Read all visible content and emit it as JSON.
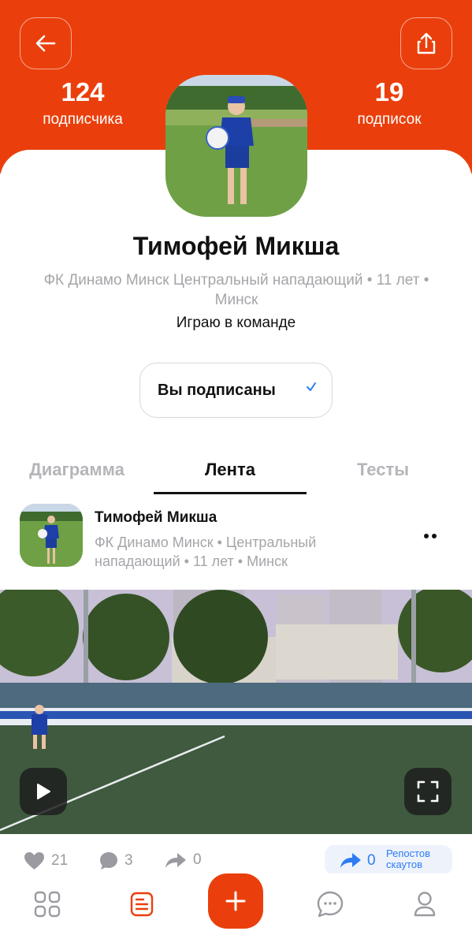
{
  "colors": {
    "accent": "#ea3f0c",
    "muted_text": "#a5a5aa",
    "link_blue": "#2d7cf6",
    "checkmark": "#2d7cf6"
  },
  "header": {
    "back_icon": "arrow-left-icon",
    "share_icon": "share-icon",
    "followers": {
      "count": "124",
      "label": "подписчика"
    },
    "following": {
      "count": "19",
      "label": "подписок"
    }
  },
  "profile": {
    "name": "Тимофей Микша",
    "meta": "ФК Динамо Минск Центральный нападающий •  11 лет • Минск",
    "status": "Играю в команде",
    "subscribe_button": "Вы подписаны",
    "subscribe_icon": "checkmark-icon"
  },
  "tabs": [
    {
      "label": "Диаграмма",
      "active": false
    },
    {
      "label": "Лента",
      "active": true
    },
    {
      "label": "Тесты",
      "active": false
    }
  ],
  "post": {
    "author": "Тимофей Микша",
    "meta": "ФК Динамо Минск •  Центральный нападающий • 11 лет • Минск",
    "more_icon": "more-dots-icon",
    "video": {
      "play_icon": "play-icon",
      "fullscreen_icon": "fullscreen-icon"
    },
    "actions": {
      "likes": "21",
      "comments": "3",
      "reposts": "0",
      "scout_reposts": {
        "count": "0",
        "label": "Репостов скаутов"
      }
    }
  },
  "bottom_nav": [
    {
      "icon": "grid-icon"
    },
    {
      "icon": "feed-icon",
      "active": true
    },
    {
      "icon": "plus-icon"
    },
    {
      "icon": "chat-icon"
    },
    {
      "icon": "profile-icon"
    }
  ]
}
